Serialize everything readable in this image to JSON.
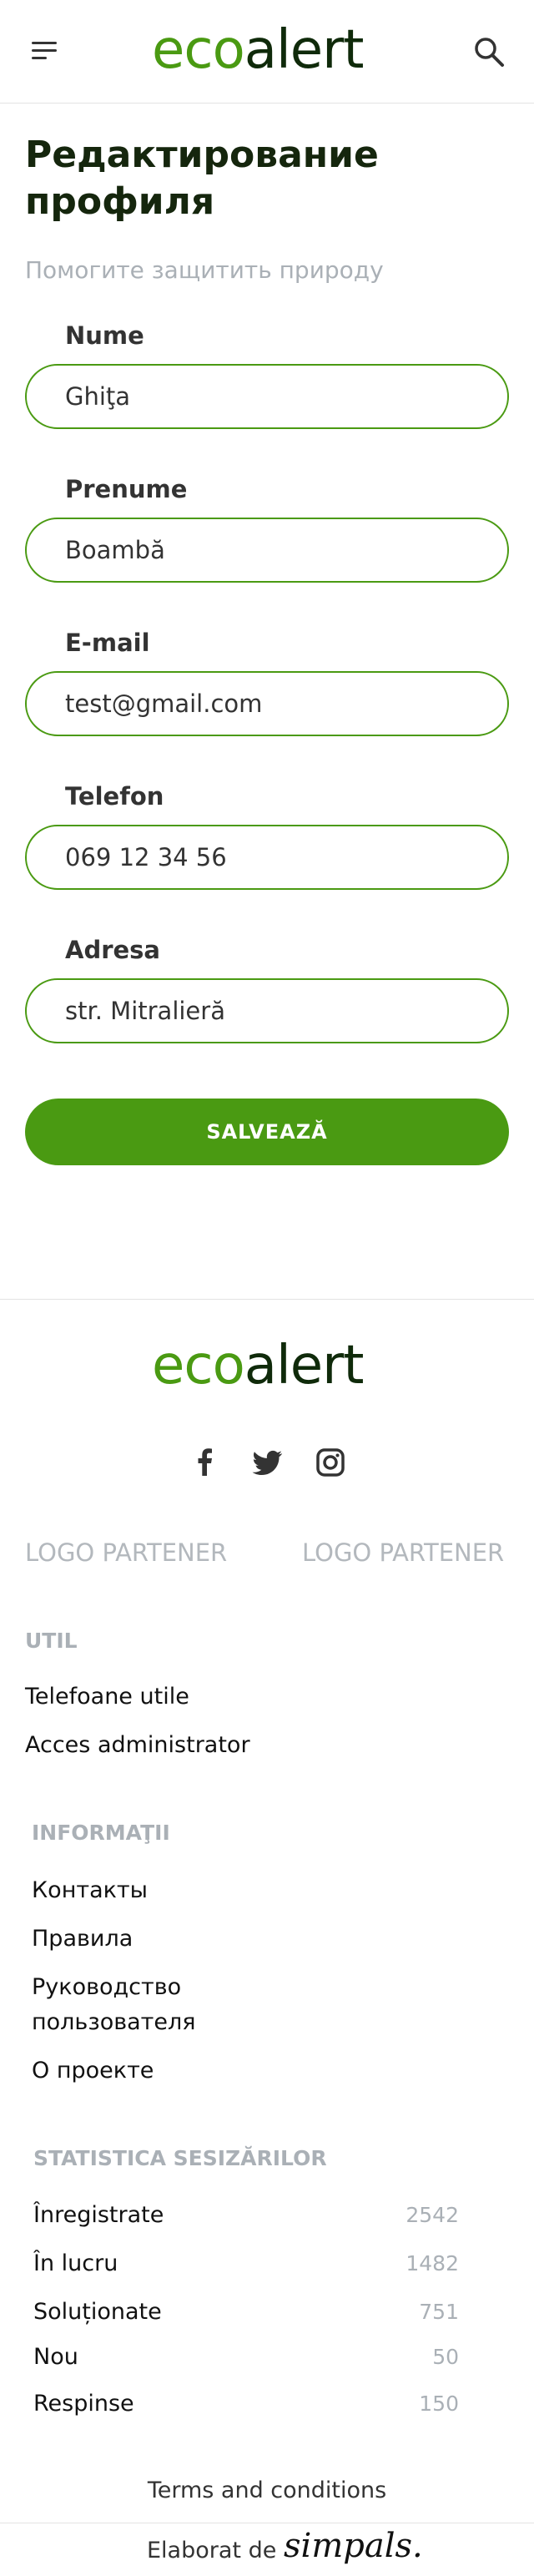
{
  "header": {
    "logo_eco": "eco",
    "logo_alert": "alert"
  },
  "page": {
    "title": "Редактирование профиля",
    "subtitle": "Помогите защитить природу"
  },
  "form": {
    "fields": [
      {
        "label": "Nume",
        "value": "Ghiţa"
      },
      {
        "label": "Prenume",
        "value": "Boambă"
      },
      {
        "label": "E-mail",
        "value": "test@gmail.com"
      },
      {
        "label": "Telefon",
        "value": "069 12 34 56"
      },
      {
        "label": "Adresa",
        "value": "str. Mitralieră"
      }
    ],
    "save_label": "SALVEAZĂ"
  },
  "footer": {
    "logo_eco": "eco",
    "logo_alert": "alert",
    "social": [
      "facebook-icon",
      "twitter-icon",
      "instagram-icon"
    ],
    "partners": [
      "LOGO PARTENER",
      "LOGO PARTENER"
    ],
    "util": {
      "title": "UTIL",
      "links": [
        "Telefoane utile",
        "Acces administrator"
      ]
    },
    "info": {
      "title": "INFORMAŢII",
      "links": [
        "Контакты",
        "Правила",
        "Руководство пользователя",
        "О проекте"
      ]
    },
    "stats": {
      "title": "STATISTICA SESIZĂRILOR",
      "rows": [
        {
          "label": "Înregistrate",
          "value": "2542"
        },
        {
          "label": "În lucru",
          "value": "1482"
        },
        {
          "label": "Soluționate",
          "value": "751"
        },
        {
          "label": "Nou",
          "value": "50"
        },
        {
          "label": "Respinse",
          "value": "150"
        }
      ]
    },
    "terms": "Terms and conditions",
    "elaborat": "Elaborat de",
    "simpals": "simpals."
  },
  "colors": {
    "brand_green": "#4a9a12",
    "brand_dark": "#0f2a0a",
    "muted": "#aab0b6"
  }
}
